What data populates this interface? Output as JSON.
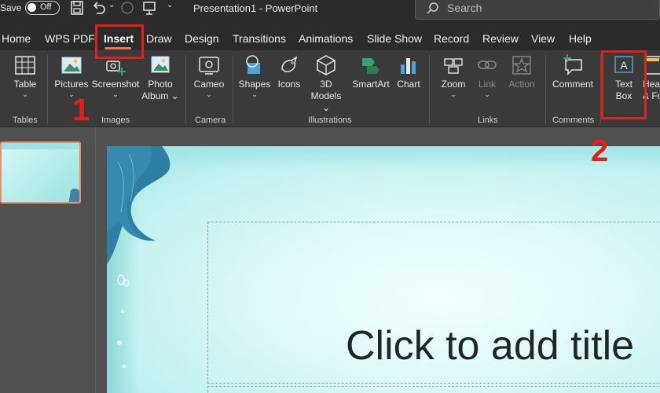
{
  "titlebar": {
    "autosave_label": "Save",
    "toggle_text": "Off",
    "document_title": "Presentation1 - PowerPoint",
    "search_placeholder": "Search"
  },
  "tabs": [
    {
      "label": "Home"
    },
    {
      "label": "WPS PDF"
    },
    {
      "label": "Insert"
    },
    {
      "label": "Draw"
    },
    {
      "label": "Design"
    },
    {
      "label": "Transitions"
    },
    {
      "label": "Animations"
    },
    {
      "label": "Slide Show"
    },
    {
      "label": "Record"
    },
    {
      "label": "Review"
    },
    {
      "label": "View"
    },
    {
      "label": "Help"
    }
  ],
  "ribbon": {
    "table": {
      "label": "Table"
    },
    "pictures": {
      "label": "Pictures"
    },
    "screenshot": {
      "label": "Screenshot"
    },
    "photo_album": {
      "line1": "Photo",
      "line2": "Album"
    },
    "cameo": {
      "label": "Cameo"
    },
    "shapes": {
      "label": "Shapes"
    },
    "icons": {
      "label": "Icons"
    },
    "models3d": {
      "line1": "3D",
      "line2": "Models"
    },
    "smartart": {
      "label": "SmartArt"
    },
    "chart": {
      "label": "Chart"
    },
    "zoom": {
      "label": "Zoom"
    },
    "link": {
      "label": "Link"
    },
    "action": {
      "label": "Action"
    },
    "comment": {
      "label": "Comment"
    },
    "textbox": {
      "line1": "Text",
      "line2": "Box"
    },
    "header_footer": {
      "line1": "Hea",
      "line2": "& Fo"
    },
    "groups": {
      "tables": "Tables",
      "images": "Images",
      "camera": "Camera",
      "illustrations": "Illustrations",
      "links": "Links",
      "comments": "Comments"
    }
  },
  "slide": {
    "title_placeholder": "Click to add title"
  },
  "annotations": {
    "step1": "1",
    "step2": "2"
  },
  "colors": {
    "annotation_red": "#e0201a",
    "active_tab_underline": "#e8785c"
  }
}
